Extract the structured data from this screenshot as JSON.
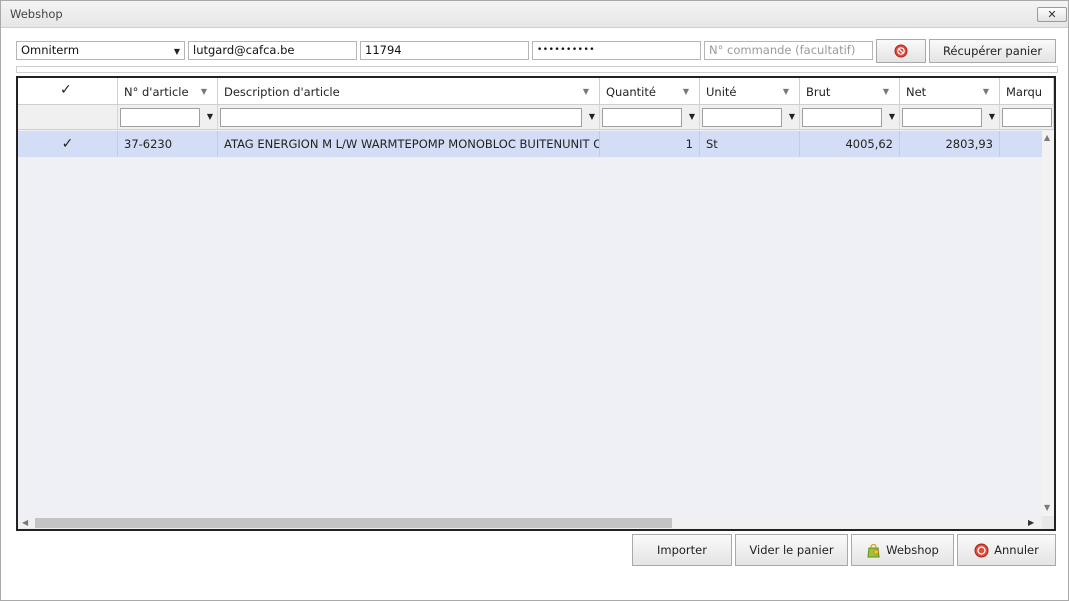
{
  "window": {
    "title": "Webshop",
    "close_glyph": "✕"
  },
  "form": {
    "supplier": "Omniterm",
    "email": "lutgard@cafca.be",
    "customer_no": "11794",
    "password_mask": "••••••••••",
    "order_placeholder": "N° commande (facultatif)",
    "retrieve_label": "Récupérer panier"
  },
  "grid": {
    "columns": [
      "N° d'article",
      "Description d'article",
      "Quantité",
      "Unité",
      "Brut",
      "Net",
      "Marqu"
    ],
    "rows": [
      {
        "checked": "✓",
        "article_no": "37-6230",
        "description": "ATAG ENERGION M L/W WARMTEPOMP MONOBLOC BUITENUNIT OD",
        "quantity": "1",
        "unit": "St",
        "brut": "4005,62",
        "net": "2803,93"
      }
    ],
    "header_check": "✓"
  },
  "buttons": {
    "import": "Importer",
    "empty_cart": "Vider le panier",
    "webshop": "Webshop",
    "cancel": "Annuler"
  },
  "icons": {
    "cancel_icon_color": "#d93a2b",
    "webshop_icon_color": "#8bb52e",
    "clear_icon_color": "#d93a2b"
  }
}
